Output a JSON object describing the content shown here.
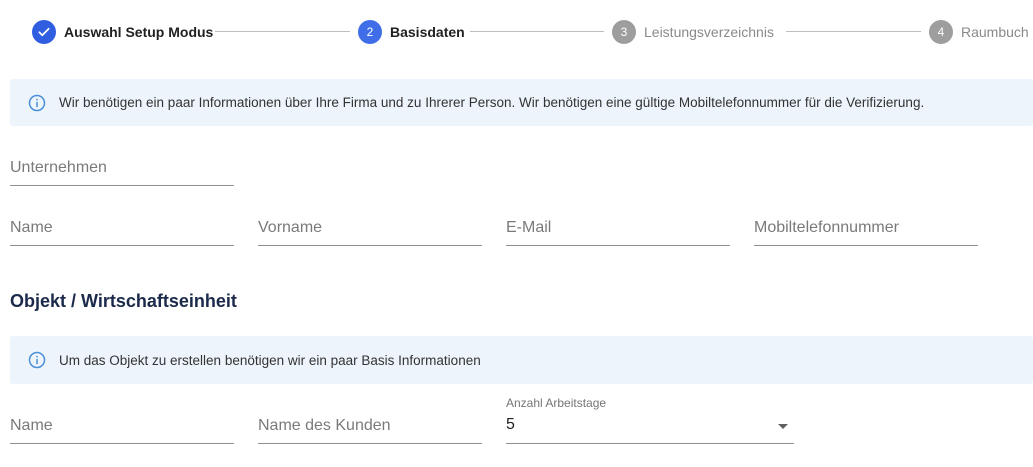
{
  "stepper": {
    "steps": [
      {
        "number": "✓",
        "label": "Auswahl Setup Modus",
        "state": "done"
      },
      {
        "number": "2",
        "label": "Basisdaten",
        "state": "active"
      },
      {
        "number": "3",
        "label": "Leistungsverzeichnis",
        "state": "pending"
      },
      {
        "number": "4",
        "label": "Raumbuch",
        "state": "pending"
      }
    ]
  },
  "company_info": {
    "text": "Wir benötigen ein paar Informationen über Ihre Firma und zu Ihrerer Person. Wir benötigen eine gültige Mobiltelefonnummer für die Verifizierung."
  },
  "company_form": {
    "unternehmen_placeholder": "Unternehmen",
    "name_placeholder": "Name",
    "vorname_placeholder": "Vorname",
    "email_placeholder": "E-Mail",
    "mobile_placeholder": "Mobiltelefonnummer"
  },
  "object_section": {
    "title": "Objekt / Wirtschaftseinheit",
    "info_text": "Um das Objekt zu erstellen benötigen wir ein paar Basis Informationen",
    "name_placeholder": "Name",
    "customer_placeholder": "Name des Kunden",
    "workdays_label": "Anzahl Arbeitstage",
    "workdays_value": "5"
  },
  "colors": {
    "accent": "#2f5fe0",
    "banner_bg": "#edf4fc",
    "info_icon": "#4a90d9"
  }
}
